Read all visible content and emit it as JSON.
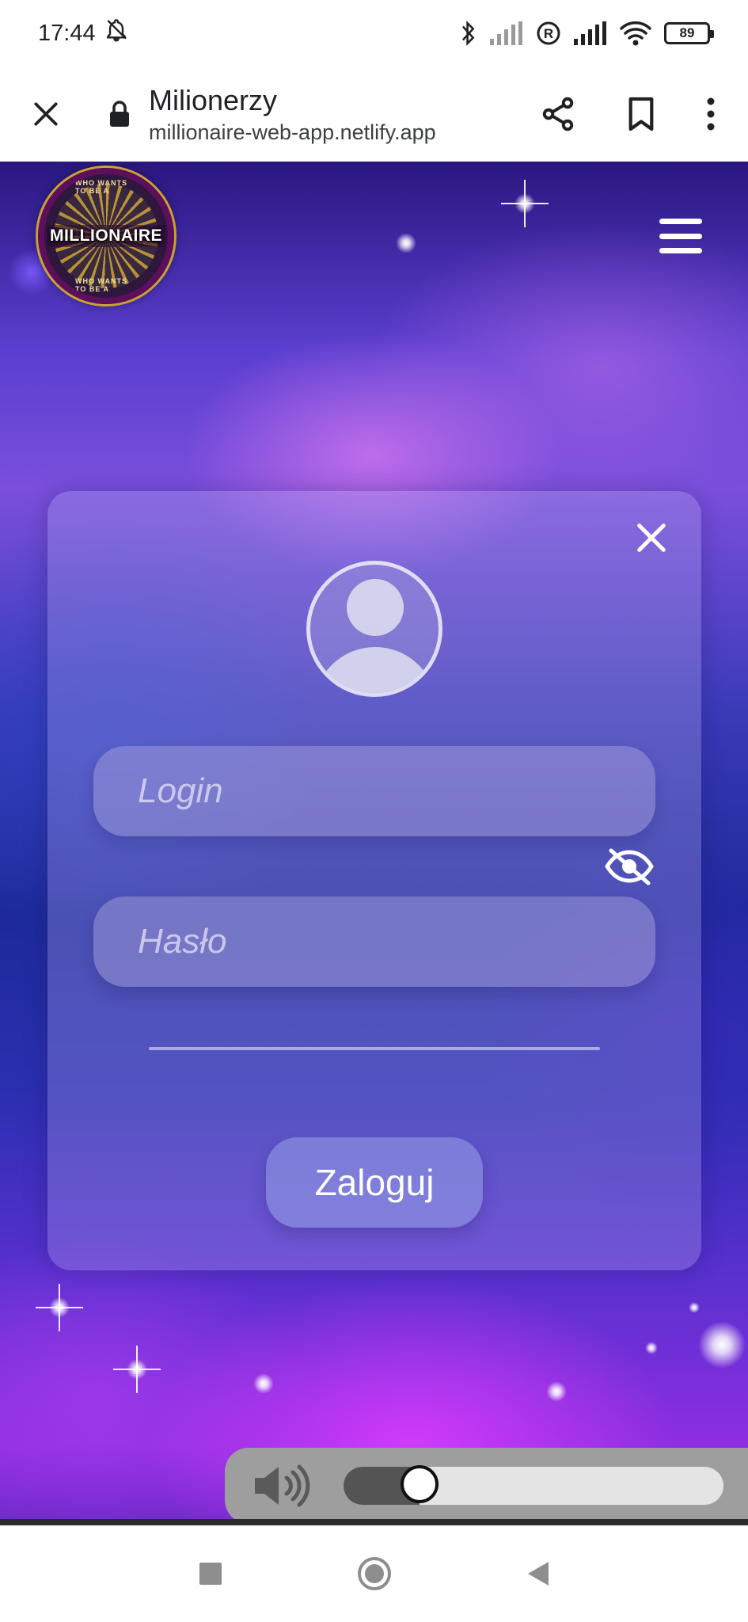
{
  "status_bar": {
    "time": "17:44",
    "battery_level": "89",
    "icons": [
      "bell-off-icon",
      "bluetooth-icon",
      "signal-icon",
      "roaming-icon",
      "signal-icon",
      "wifi-icon",
      "battery-icon"
    ]
  },
  "browser": {
    "page_title": "Milionerzy",
    "url": "millionaire-web-app.netlify.app",
    "icons": [
      "close-icon",
      "lock-icon",
      "share-icon",
      "bookmark-icon",
      "more-vert-icon"
    ]
  },
  "header": {
    "logo": {
      "ring_text_top": "WHO WANTS TO BE A",
      "main_text": "MILLIONAIRE",
      "ring_text_bottom": "WHO WANTS TO BE A"
    },
    "menu_icon": "hamburger-menu-icon"
  },
  "login_card": {
    "close_icon": "close-icon",
    "avatar_icon": "user-avatar-icon",
    "login_field": {
      "placeholder": "Login",
      "value": ""
    },
    "password_field": {
      "placeholder": "Hasło",
      "value": ""
    },
    "visibility_icon": "eye-off-icon",
    "submit_label": "Zaloguj"
  },
  "audio_control": {
    "icon": "volume-icon",
    "volume_fraction": 0.2
  },
  "nav_bar": {
    "icons": [
      "recents-square-icon",
      "home-circle-icon",
      "back-triangle-icon"
    ]
  },
  "colors": {
    "accent_purple": "#7a4fdc",
    "card_background": "#b4aaeb",
    "slider_fill": "#545454"
  }
}
